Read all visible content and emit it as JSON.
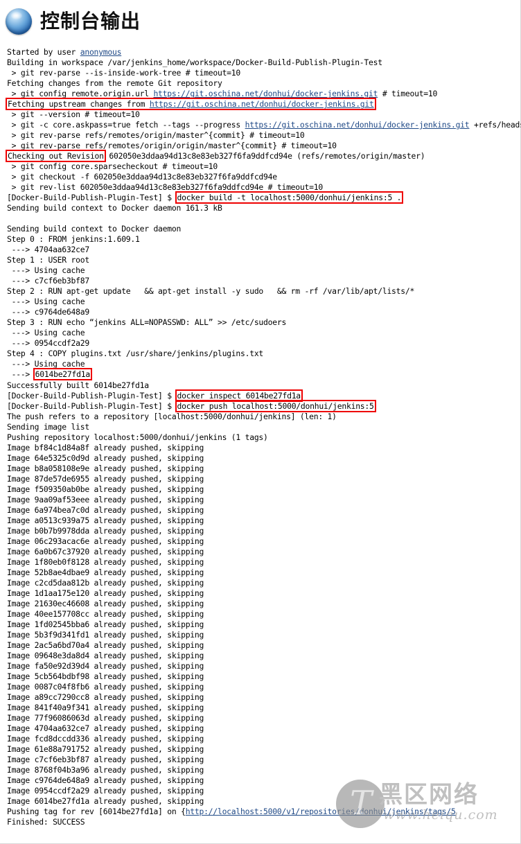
{
  "header": {
    "title": "控制台输出",
    "icon": "blue-sphere-icon"
  },
  "colors": {
    "highlight_box": "#ee0000",
    "link": "#204a87",
    "text": "#000000",
    "background": "#ffffff",
    "watermark": "#9a9a9a"
  },
  "watermark": {
    "logo_letter": "T",
    "brand_cn": "黑区网络",
    "url": "www.heiqu.com"
  },
  "console": {
    "lines": [
      {
        "id": "l0",
        "segments": [
          {
            "t": "Started by user "
          },
          {
            "t": "anonymous",
            "k": "link"
          }
        ]
      },
      {
        "id": "l1",
        "segments": [
          {
            "t": "Building in workspace /var/jenkins_home/workspace/Docker-Build-Publish-Plugin-Test"
          }
        ]
      },
      {
        "id": "l2",
        "segments": [
          {
            "t": " > git rev-parse --is-inside-work-tree # timeout=10"
          }
        ]
      },
      {
        "id": "l3",
        "segments": [
          {
            "t": "Fetching changes from the remote Git repository"
          }
        ]
      },
      {
        "id": "l4",
        "segments": [
          {
            "t": " > git config remote.origin.url "
          },
          {
            "t": "https://git.oschina.net/donhui/docker-jenkins.git",
            "k": "link"
          },
          {
            "t": " # timeout=10"
          }
        ]
      },
      {
        "id": "l5",
        "segments": [
          {
            "t": "Fetching upstream changes from ",
            "k": "box-start"
          },
          {
            "t": "https://git.oschina.net/donhui/docker-jenkins.git",
            "k": "link-box-end"
          }
        ],
        "box": true
      },
      {
        "id": "l6",
        "segments": [
          {
            "t": " > git --version # timeout=10"
          }
        ]
      },
      {
        "id": "l7",
        "segments": [
          {
            "t": " > git -c core.askpass=true fetch --tags --progress "
          },
          {
            "t": "https://git.oschina.net/donhui/docker-jenkins.git",
            "k": "link"
          },
          {
            "t": " +refs/heads,"
          }
        ]
      },
      {
        "id": "l8",
        "segments": [
          {
            "t": " > git rev-parse refs/remotes/origin/master^{commit} # timeout=10"
          }
        ]
      },
      {
        "id": "l9",
        "segments": [
          {
            "t": " > git rev-parse refs/remotes/origin/origin/master^{commit} # timeout=10"
          }
        ]
      },
      {
        "id": "l10",
        "segments": [
          {
            "t": "Checking out Revision",
            "k": "box"
          },
          {
            "t": " 602050e3ddaa94d13c8e83eb327f6fa9ddfcd94e (refs/remotes/origin/master)"
          }
        ]
      },
      {
        "id": "l11",
        "segments": [
          {
            "t": " > git config core.sparsecheckout # timeout=10"
          }
        ]
      },
      {
        "id": "l12",
        "segments": [
          {
            "t": " > git checkout -f 602050e3ddaa94d13c8e83eb327f6fa9ddfcd94e"
          }
        ]
      },
      {
        "id": "l13",
        "segments": [
          {
            "t": " > git rev-list 602050e3ddaa94d13c8e83eb327f6fa9ddfcd94e # timeout=10"
          }
        ]
      },
      {
        "id": "l14",
        "segments": [
          {
            "t": "[Docker-Build-Publish-Plugin-Test] $ "
          },
          {
            "t": "docker build -t localhost:5000/donhui/jenkins:5 .",
            "k": "box"
          }
        ]
      },
      {
        "id": "l15",
        "segments": [
          {
            "t": "Sending build context to Docker daemon 161.3 kB"
          }
        ]
      },
      {
        "id": "l16",
        "segments": [
          {
            "t": ""
          }
        ]
      },
      {
        "id": "l17",
        "segments": [
          {
            "t": "Sending build context to Docker daemon"
          }
        ]
      },
      {
        "id": "l18",
        "segments": [
          {
            "t": "Step 0 : FROM jenkins:1.609.1"
          }
        ]
      },
      {
        "id": "l19",
        "segments": [
          {
            "t": " ---> 4704aa632ce7"
          }
        ]
      },
      {
        "id": "l20",
        "segments": [
          {
            "t": "Step 1 : USER root"
          }
        ]
      },
      {
        "id": "l21",
        "segments": [
          {
            "t": " ---> Using cache"
          }
        ]
      },
      {
        "id": "l22",
        "segments": [
          {
            "t": " ---> c7cf6eb3bf87"
          }
        ]
      },
      {
        "id": "l23",
        "segments": [
          {
            "t": "Step 2 : RUN apt-get update   && apt-get install -y sudo   && rm -rf /var/lib/apt/lists/*"
          }
        ]
      },
      {
        "id": "l24",
        "segments": [
          {
            "t": " ---> Using cache"
          }
        ]
      },
      {
        "id": "l25",
        "segments": [
          {
            "t": " ---> c9764de648a9"
          }
        ]
      },
      {
        "id": "l26",
        "segments": [
          {
            "t": "Step 3 : RUN echo “jenkins ALL=NOPASSWD: ALL” >> /etc/sudoers"
          }
        ]
      },
      {
        "id": "l27",
        "segments": [
          {
            "t": " ---> Using cache"
          }
        ]
      },
      {
        "id": "l28",
        "segments": [
          {
            "t": " ---> 0954ccdf2a29"
          }
        ]
      },
      {
        "id": "l29",
        "segments": [
          {
            "t": "Step 4 : COPY plugins.txt /usr/share/jenkins/plugins.txt"
          }
        ]
      },
      {
        "id": "l30",
        "segments": [
          {
            "t": " ---> Using cache"
          }
        ]
      },
      {
        "id": "l31",
        "segments": [
          {
            "t": " ---> "
          },
          {
            "t": "6014be27fd1a",
            "k": "box"
          }
        ]
      },
      {
        "id": "l32",
        "segments": [
          {
            "t": "Successfully built 6014be27fd1a"
          }
        ]
      },
      {
        "id": "l33",
        "segments": [
          {
            "t": "[Docker-Build-Publish-Plugin-Test] $ "
          },
          {
            "t": "docker inspect 6014be27fd1a",
            "k": "box"
          }
        ]
      },
      {
        "id": "l34",
        "segments": [
          {
            "t": "[Docker-Build-Publish-Plugin-Test] $ "
          },
          {
            "t": "docker push localhost:5000/donhui/jenkins:5",
            "k": "box"
          }
        ]
      },
      {
        "id": "l35",
        "segments": [
          {
            "t": "The push refers to a repository [localhost:5000/donhui/jenkins] (len: 1)"
          }
        ]
      },
      {
        "id": "l36",
        "segments": [
          {
            "t": "Sending image list"
          }
        ]
      },
      {
        "id": "l37",
        "segments": [
          {
            "t": "Pushing repository localhost:5000/donhui/jenkins (1 tags)"
          }
        ]
      },
      {
        "id": "l38",
        "segments": [
          {
            "t": "Image bf84c1d84a8f already pushed, skipping"
          }
        ]
      },
      {
        "id": "l39",
        "segments": [
          {
            "t": "Image 64e5325c0d9d already pushed, skipping"
          }
        ]
      },
      {
        "id": "l40",
        "segments": [
          {
            "t": "Image b8a058108e9e already pushed, skipping"
          }
        ]
      },
      {
        "id": "l41",
        "segments": [
          {
            "t": "Image 87de57de6955 already pushed, skipping"
          }
        ]
      },
      {
        "id": "l42",
        "segments": [
          {
            "t": "Image f509350ab0be already pushed, skipping"
          }
        ]
      },
      {
        "id": "l43",
        "segments": [
          {
            "t": "Image 9aa09af53eee already pushed, skipping"
          }
        ]
      },
      {
        "id": "l44",
        "segments": [
          {
            "t": "Image 6a974bea7c0d already pushed, skipping"
          }
        ]
      },
      {
        "id": "l45",
        "segments": [
          {
            "t": "Image a0513c939a75 already pushed, skipping"
          }
        ]
      },
      {
        "id": "l46",
        "segments": [
          {
            "t": "Image b0b7b9978dda already pushed, skipping"
          }
        ]
      },
      {
        "id": "l47",
        "segments": [
          {
            "t": "Image 06c293acac6e already pushed, skipping"
          }
        ]
      },
      {
        "id": "l48",
        "segments": [
          {
            "t": "Image 6a0b67c37920 already pushed, skipping"
          }
        ]
      },
      {
        "id": "l49",
        "segments": [
          {
            "t": "Image 1f80eb0f8128 already pushed, skipping"
          }
        ]
      },
      {
        "id": "l50",
        "segments": [
          {
            "t": "Image 52b8ae4dbae9 already pushed, skipping"
          }
        ]
      },
      {
        "id": "l51",
        "segments": [
          {
            "t": "Image c2cd5daa812b already pushed, skipping"
          }
        ]
      },
      {
        "id": "l52",
        "segments": [
          {
            "t": "Image 1d1aa175e120 already pushed, skipping"
          }
        ]
      },
      {
        "id": "l53",
        "segments": [
          {
            "t": "Image 21630ec46608 already pushed, skipping"
          }
        ]
      },
      {
        "id": "l54",
        "segments": [
          {
            "t": "Image 40ee157708cc already pushed, skipping"
          }
        ]
      },
      {
        "id": "l55",
        "segments": [
          {
            "t": "Image 1fd02545bba6 already pushed, skipping"
          }
        ]
      },
      {
        "id": "l56",
        "segments": [
          {
            "t": "Image 5b3f9d341fd1 already pushed, skipping"
          }
        ]
      },
      {
        "id": "l57",
        "segments": [
          {
            "t": "Image 2ac5a6bd70a4 already pushed, skipping"
          }
        ]
      },
      {
        "id": "l58",
        "segments": [
          {
            "t": "Image 09648e3da8d4 already pushed, skipping"
          }
        ]
      },
      {
        "id": "l59",
        "segments": [
          {
            "t": "Image fa50e92d39d4 already pushed, skipping"
          }
        ]
      },
      {
        "id": "l60",
        "segments": [
          {
            "t": "Image 5cb564bdbf98 already pushed, skipping"
          }
        ]
      },
      {
        "id": "l61",
        "segments": [
          {
            "t": "Image 0087c04f8fb6 already pushed, skipping"
          }
        ]
      },
      {
        "id": "l62",
        "segments": [
          {
            "t": "Image a89cc7290cc8 already pushed, skipping"
          }
        ]
      },
      {
        "id": "l63",
        "segments": [
          {
            "t": "Image 841f40a9f341 already pushed, skipping"
          }
        ]
      },
      {
        "id": "l64",
        "segments": [
          {
            "t": "Image 77f96086063d already pushed, skipping"
          }
        ]
      },
      {
        "id": "l65",
        "segments": [
          {
            "t": "Image 4704aa632ce7 already pushed, skipping"
          }
        ]
      },
      {
        "id": "l66",
        "segments": [
          {
            "t": "Image fcd8dccdd336 already pushed, skipping"
          }
        ]
      },
      {
        "id": "l67",
        "segments": [
          {
            "t": "Image 61e88a791752 already pushed, skipping"
          }
        ]
      },
      {
        "id": "l68",
        "segments": [
          {
            "t": "Image c7cf6eb3bf87 already pushed, skipping"
          }
        ]
      },
      {
        "id": "l69",
        "segments": [
          {
            "t": "Image 8768f04b3a96 already pushed, skipping"
          }
        ]
      },
      {
        "id": "l70",
        "segments": [
          {
            "t": "Image c9764de648a9 already pushed, skipping"
          }
        ]
      },
      {
        "id": "l71",
        "segments": [
          {
            "t": "Image 0954ccdf2a29 already pushed, skipping"
          }
        ]
      },
      {
        "id": "l72",
        "segments": [
          {
            "t": "Image 6014be27fd1a already pushed, skipping"
          }
        ]
      },
      {
        "id": "l73",
        "segments": [
          {
            "t": "Pushing tag for rev [6014be27fd1a] on {"
          },
          {
            "t": "http://localhost:5000/v1/repositories/donhui/jenkins/tags/5",
            "k": "link"
          }
        ]
      },
      {
        "id": "l74",
        "segments": [
          {
            "t": "Finished: SUCCESS"
          }
        ]
      }
    ]
  }
}
